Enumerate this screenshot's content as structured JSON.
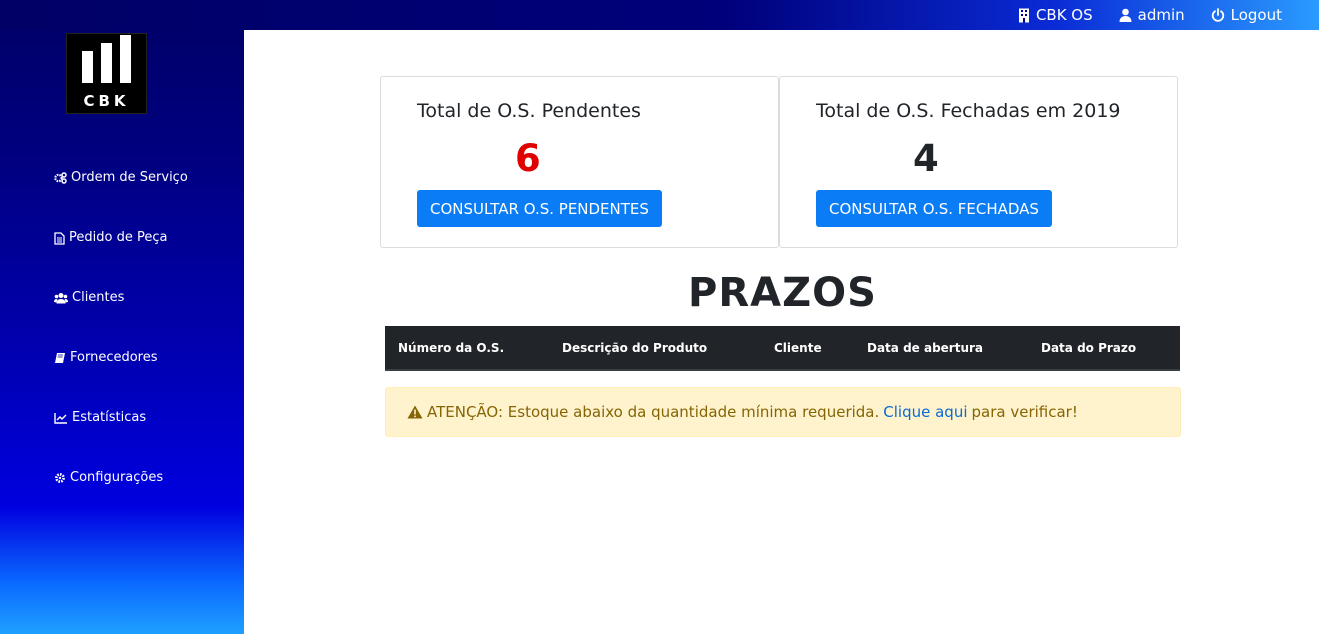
{
  "topbar": {
    "brand_label": "CBK OS",
    "user_label": "admin",
    "logout_label": "Logout"
  },
  "logo": {
    "text": "CBK"
  },
  "sidebar": {
    "items": [
      {
        "label": "Ordem de Serviço",
        "icon": "gears-icon"
      },
      {
        "label": "Pedido de Peça",
        "icon": "document-icon"
      },
      {
        "label": "Clientes",
        "icon": "users-icon"
      },
      {
        "label": "Fornecedores",
        "icon": "book-icon"
      },
      {
        "label": "Estatísticas",
        "icon": "line-chart-icon"
      },
      {
        "label": "Configurações",
        "icon": "gear-icon"
      }
    ]
  },
  "cards": {
    "pending": {
      "title": "Total de O.S. Pendentes",
      "count": "6",
      "button": "CONSULTAR O.S. PENDENTES",
      "count_color": "#e00000"
    },
    "closed": {
      "title": "Total de O.S. Fechadas em 2019",
      "count": "4",
      "button": "CONSULTAR O.S. FECHADAS"
    }
  },
  "prazos": {
    "heading": "PRAZOS",
    "columns": [
      "Número da O.S.",
      "Descrição do Produto",
      "Cliente",
      "Data de abertura",
      "Data do Prazo"
    ]
  },
  "alert": {
    "prefix": "ATENÇÃO: Estoque abaixo da quantidade mínima requerida.",
    "link": "Clique aqui",
    "suffix": "para verificar!"
  },
  "colors": {
    "primary_button": "#0a7cf5",
    "alert_bg": "#fff3cd",
    "table_header": "#212529"
  }
}
